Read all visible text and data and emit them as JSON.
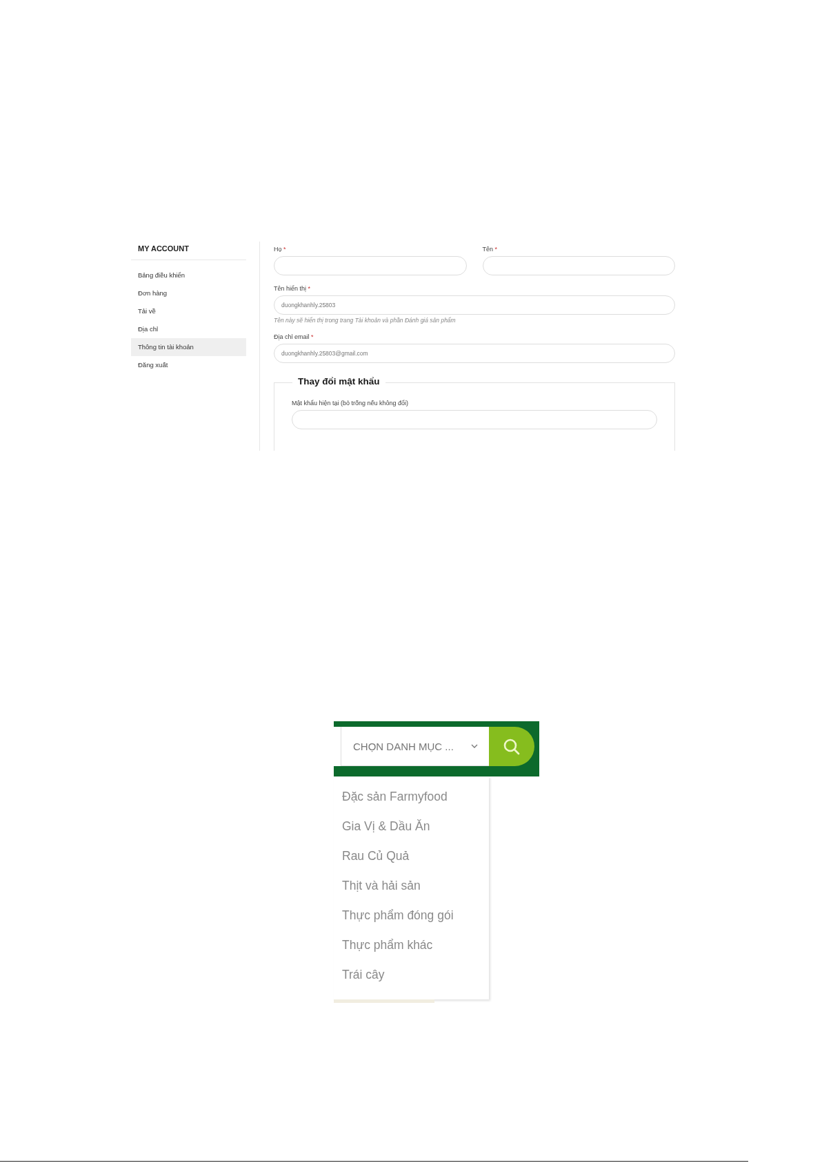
{
  "account": {
    "sidebar": {
      "title": "MY ACCOUNT",
      "items": [
        {
          "label": "Bảng điều khiển",
          "selected": false
        },
        {
          "label": "Đơn hàng",
          "selected": false
        },
        {
          "label": "Tải về",
          "selected": false
        },
        {
          "label": "Địa chỉ",
          "selected": false
        },
        {
          "label": "Thông tin tài khoản",
          "selected": true
        },
        {
          "label": "Đăng xuất",
          "selected": false
        }
      ]
    },
    "name_fields": [
      {
        "label": "Họ",
        "required_mark": "*"
      },
      {
        "label": "Tên",
        "required_mark": "*"
      }
    ],
    "fields": [
      {
        "label": "Tên hiển thị",
        "required_mark": "*",
        "value": "duongkhanhly.25803",
        "hint": "Tên này sẽ hiển thị trong trang Tài khoản và phần Đánh giá sản phẩm"
      },
      {
        "label": "Địa chỉ email",
        "required_mark": "*",
        "value": "duongkhanhly.25803@gmail.com"
      }
    ],
    "password_section": {
      "legend": "Thay đổi mật khẩu",
      "field_label": "Mật khẩu hiện tại (bỏ trống nếu không đổi)"
    }
  },
  "category_search": {
    "select": "CHỌN DANH MỤC ...",
    "options": [
      "Đặc sản Farmyfood",
      "Gia Vị & Dầu Ăn",
      "Rau Củ Quả",
      "Thịt và hải sản",
      "Thực phẩm đóng gói",
      "Thực phẩm khác",
      "Trái cây"
    ]
  }
}
